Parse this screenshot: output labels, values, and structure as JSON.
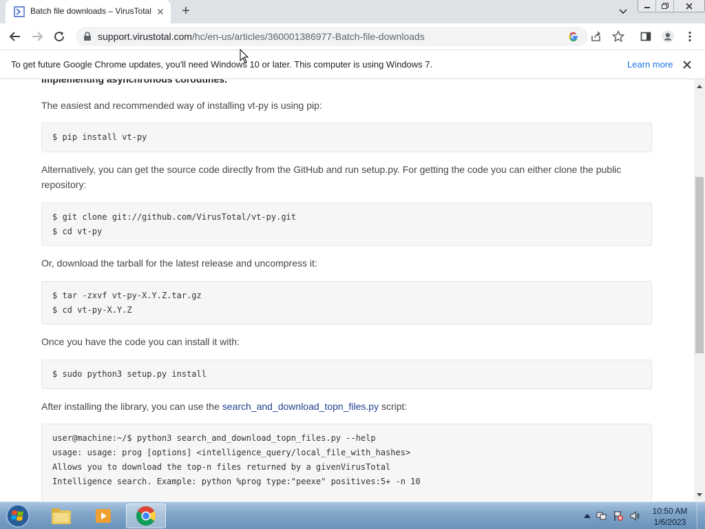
{
  "browser": {
    "tab": {
      "title": "Batch file downloads – VirusTotal",
      "close_glyph": "✕"
    },
    "new_tab_glyph": "+",
    "address": {
      "host": "support.virustotal.com",
      "path": "/hc/en-us/articles/360001386977-Batch-file-downloads"
    },
    "icons": [
      "back-icon",
      "forward-icon",
      "reload-icon",
      "lock-icon",
      "google-icon",
      "share-icon",
      "star-icon",
      "side-panel-icon",
      "profile-icon",
      "menu-icon"
    ]
  },
  "infobar": {
    "message": "To get future Google Chrome updates, you'll need Windows 10 or later. This computer is using Windows 7.",
    "link": "Learn more",
    "close_glyph": "✕"
  },
  "article": {
    "cut_heading": "implementing asynchronous coroutines.",
    "p1": "The easiest and recommended way of installing vt-py is using pip:",
    "code1": [
      "$ pip install vt-py"
    ],
    "p2": "Alternatively, you can get the source code directly from the GitHub and run setup.py. For getting the code you can either clone the public repository:",
    "code2": [
      "$ git clone git://github.com/VirusTotal/vt-py.git",
      "$ cd vt-py"
    ],
    "p3": "Or, download the tarball for the latest release and uncompress it:",
    "code3": [
      "$ tar -zxvf vt-py-X.Y.Z.tar.gz",
      "$ cd vt-py-X.Y.Z"
    ],
    "p4": "Once you have the code you can install it with:",
    "code4": [
      "$ sudo python3 setup.py install"
    ],
    "p5_before": "After installing the library, you can use the ",
    "p5_link": "search_and_download_topn_files.py",
    "p5_after": " script:",
    "code5": [
      "user@machine:~/$ python3 search_and_download_topn_files.py --help",
      "usage: usage: prog [options] <intelligence_query/local_file_with_hashes>",
      "",
      "Allows you to download the top-n files returned by a givenVirusTotal",
      "Intelligence search. Example: python %prog type:\"peexe\" positives:5+ -n 10"
    ]
  },
  "taskbar": {
    "apps": [
      "windows-explorer",
      "media-player",
      "google-chrome"
    ],
    "time": "10:50 AM",
    "date": "1/6/2023"
  },
  "colors": {
    "tabstrip": "#dee1e6",
    "link": "#1a73e8",
    "article_link": "#1f3f8f",
    "code_bg": "#f6f6f6"
  }
}
